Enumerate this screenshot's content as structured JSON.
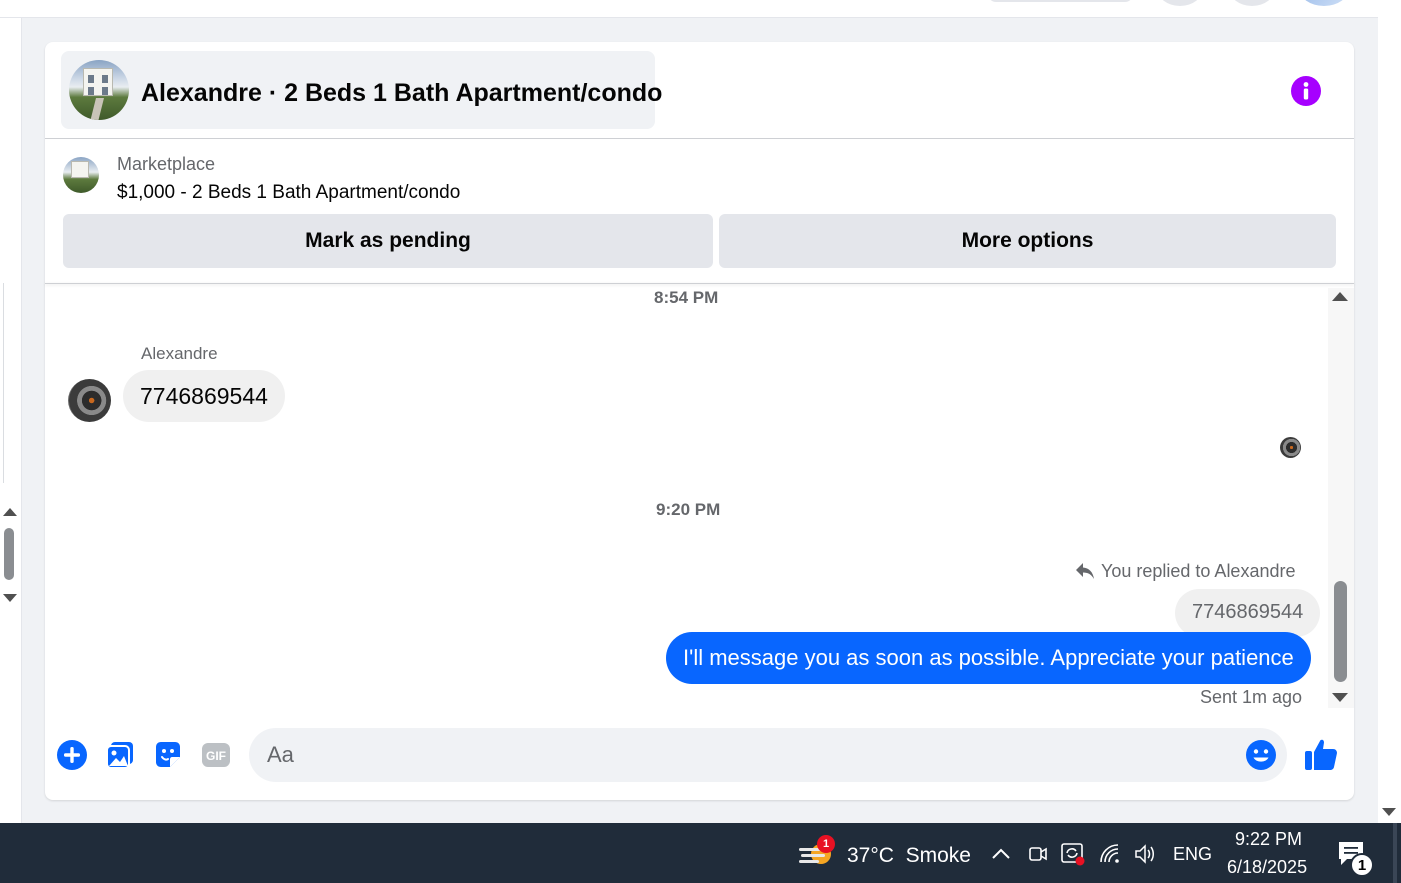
{
  "header": {
    "title": "Alexandre · 2 Beds 1 Bath Apartment/condo"
  },
  "marketplace": {
    "label": "Marketplace",
    "listing": "$1,000 - 2 Beds 1 Bath Apartment/condo",
    "mark_pending_label": "Mark as pending",
    "more_options_label": "More options"
  },
  "messages": {
    "timestamp_1": "8:54 PM",
    "sender_name": "Alexandre",
    "incoming_text": "7746869544",
    "timestamp_2": "9:20 PM",
    "reply_context": "You replied to Alexandre",
    "quoted_text": "7746869544",
    "outgoing_text": "I'll message you as soon as possible. Appreciate your patience",
    "sent_status": "Sent 1m ago"
  },
  "composer": {
    "placeholder": "Aa"
  },
  "taskbar": {
    "weather_badge": "1",
    "weather": "37°C  Smoke",
    "language": "ENG",
    "time": "9:22 PM",
    "date": "6/18/2025",
    "notification_count": "1"
  },
  "colors": {
    "accent_blue": "#0866ff",
    "info_purple": "#a600ff",
    "taskbar": "#202c3a"
  },
  "icons": {
    "info": "info-icon",
    "add": "plus-circle-icon",
    "photo": "photo-icon",
    "sticker": "sticker-icon",
    "gif": "gif-icon",
    "emoji": "emoji-icon",
    "like": "thumbs-up-icon",
    "reply": "reply-arrow-icon"
  }
}
